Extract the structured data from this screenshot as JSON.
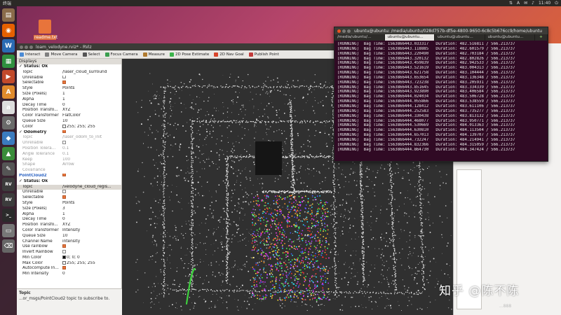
{
  "topbar": {
    "left_label": "终端",
    "time": "11:40",
    "tray": [
      "⇅",
      "A",
      "✉",
      "♪",
      "⏻"
    ]
  },
  "launcher": {
    "items": [
      {
        "name": "files",
        "glyph": "▤",
        "color": "#8a6b4a"
      },
      {
        "name": "firefox",
        "glyph": "◉",
        "color": "#e66000"
      },
      {
        "name": "writer",
        "glyph": "W",
        "color": "#2a6bb3"
      },
      {
        "name": "calc",
        "glyph": "▦",
        "color": "#2f8f3f"
      },
      {
        "name": "impress",
        "glyph": "▶",
        "color": "#c2492b"
      },
      {
        "name": "software",
        "glyph": "A",
        "color": "#e08a2c"
      },
      {
        "name": "amazon",
        "glyph": "a",
        "color": "#dddddd"
      },
      {
        "name": "settings",
        "glyph": "⚙",
        "color": "#6a6a6a"
      },
      {
        "name": "app-blue",
        "glyph": "◆",
        "color": "#3b7bbf"
      },
      {
        "name": "app-green",
        "glyph": "▲",
        "color": "#3a8c3a"
      },
      {
        "name": "editor",
        "glyph": "✎",
        "color": "#555555"
      },
      {
        "name": "rviz-1",
        "glyph": "RV",
        "color": "#3c3c3c"
      },
      {
        "name": "rviz-2",
        "glyph": "RV",
        "color": "#3c3c3c"
      },
      {
        "name": "terminal",
        "glyph": ">_",
        "color": "#2b2b2b"
      },
      {
        "name": "drive",
        "glyph": "▭",
        "color": "#777777"
      },
      {
        "name": "trash",
        "glyph": "⌫",
        "color": "#666666"
      }
    ]
  },
  "desktop": {
    "file_label": "readme.txt"
  },
  "rviz": {
    "title": "loam_velodyne.rviz* - RViz",
    "toolbar": [
      "Interact",
      "Move Camera",
      "Select",
      "Focus Camera",
      "Measure",
      "2D Pose Estimate",
      "2D Nav Goal",
      "Publish Point"
    ],
    "tool_colors": [
      "#4b8bd6",
      "#7f7f7f",
      "#555555",
      "#3a9e4e",
      "#b07a2f",
      "#3cb44b",
      "#d9452b",
      "#c23b3b"
    ],
    "panel_title": "Displays",
    "properties": [
      {
        "k": "✓ Status: Ok",
        "v": "",
        "type": "head"
      },
      {
        "k": "Topic",
        "v": "/laser_cloud_surround"
      },
      {
        "k": "Unreliable",
        "v": "",
        "cb": "off"
      },
      {
        "k": "Selectable",
        "v": "",
        "cb": "on"
      },
      {
        "k": "Style",
        "v": "Points"
      },
      {
        "k": "Size (Pixels)",
        "v": "1"
      },
      {
        "k": "Alpha",
        "v": "1"
      },
      {
        "k": "Decay Time",
        "v": "0"
      },
      {
        "k": "Position Transfo...",
        "v": "XYZ"
      },
      {
        "k": "Color Transformer",
        "v": "FlatColor"
      },
      {
        "k": "Queue Size",
        "v": "10"
      },
      {
        "k": "Color",
        "v": "255; 255; 255",
        "swatch": "#ffffff"
      },
      {
        "k": "✓ Odometry",
        "v": "",
        "type": "head",
        "cb": "on"
      },
      {
        "k": "Topic",
        "v": "/laser_odom_to_init",
        "type": "gray"
      },
      {
        "k": "Unreliable",
        "v": "",
        "type": "gray",
        "cb": "off"
      },
      {
        "k": "Position Tolera...",
        "v": "0.1",
        "type": "gray"
      },
      {
        "k": "Angle Tolerance",
        "v": "0.1",
        "type": "gray"
      },
      {
        "k": "Keep",
        "v": "100",
        "type": "gray"
      },
      {
        "k": "Shape",
        "v": "Arrow",
        "type": "gray"
      },
      {
        "k": "Covariance",
        "v": "",
        "type": "gray"
      },
      {
        "k": "PointCloud2",
        "v": "",
        "type": "blue",
        "cb": "on"
      },
      {
        "k": "✓ Status: Ok",
        "v": "",
        "type": "head"
      },
      {
        "k": "Topic",
        "v": "/velodyne_cloud_regis...",
        "type": "sel"
      },
      {
        "k": "Unreliable",
        "v": "",
        "cb": "off"
      },
      {
        "k": "Selectable",
        "v": "",
        "cb": "on"
      },
      {
        "k": "Style",
        "v": "Points"
      },
      {
        "k": "Size (Pixels)",
        "v": "3"
      },
      {
        "k": "Alpha",
        "v": "1"
      },
      {
        "k": "Decay Time",
        "v": "0"
      },
      {
        "k": "Position Transfo...",
        "v": "XYZ"
      },
      {
        "k": "Color Transformer",
        "v": "Intensity"
      },
      {
        "k": "Queue Size",
        "v": "10"
      },
      {
        "k": "Channel Name",
        "v": "intensity"
      },
      {
        "k": "Use rainbow",
        "v": "",
        "cb": "on"
      },
      {
        "k": "Invert Rainbow",
        "v": "",
        "cb": "off"
      },
      {
        "k": "Min Color",
        "v": "0; 0; 0",
        "swatch": "#000000"
      },
      {
        "k": "Max Color",
        "v": "255; 255; 255",
        "swatch": "#ffffff"
      },
      {
        "k": "Autocompute In...",
        "v": "",
        "cb": "on"
      },
      {
        "k": "Min Intensity",
        "v": "0"
      }
    ],
    "help_title": "Topic",
    "help_text": "...or_msgs/PointCloud2 topic to subscribe to."
  },
  "terminal": {
    "title": "ubuntu@ubuntu: /media/ubuntu/028d757b-df5e-4800-9650-6c8c5b676cc9/home/ubuntu",
    "tabs": [
      "/media/ubuntu/...",
      "ubuntu@ubuntu...",
      "ubuntu@ubuntu...",
      "ubuntu@ubuntu...",
      "+"
    ],
    "lines": [
      "[RUNNING]  Bag Time: 1563866443.033317   Duration: 482.516811 / 566.213737",
      "[RUNNING]  Bag Time: 1563866443.118885   Duration: 482.601579 / 566.213737",
      "[RUNNING]  Bag Time: 1563866443.220490   Duration: 482.703184 / 566.213737",
      "[RUNNING]  Bag Time: 1563866443.320132   Duration: 482.802826 / 566.213737",
      "[RUNNING]  Bag Time: 1563866443.459839   Duration: 482.942533 / 566.213737",
      "[RUNNING]  Bag Time: 1563866443.521619   Duration: 483.004313 / 566.213737",
      "[RUNNING]  Bag Time: 1563866443.621758   Duration: 483.104444 / 566.213737",
      "[RUNNING]  Bag Time: 1563866443.653654   Duration: 483.136348 / 566.213737",
      "[RUNNING]  Bag Time: 1563866443.723238   Duration: 483.205931 / 566.213737",
      "[RUNNING]  Bag Time: 1563866443.851645   Duration: 483.334339 / 566.213737",
      "[RUNNING]  Bag Time: 1563866443.923890   Duration: 483.406584 / 566.213737",
      "[RUNNING]  Bag Time: 1563866444.024034   Duration: 483.506728 / 566.213737",
      "[RUNNING]  Bag Time: 1563866444.055866   Duration: 483.538559 / 566.213737",
      "[RUNNING]  Bag Time: 1563866444.128412   Duration: 483.611106 / 566.213737",
      "[RUNNING]  Bag Time: 1563866444.252583   Duration: 483.735277 / 566.213737",
      "[RUNNING]  Bag Time: 1563866444.330438   Duration: 483.813132 / 566.213737",
      "[RUNNING]  Bag Time: 1563866444.468077   Duration: 483.950771 / 566.213737",
      "[RUNNING]  Bag Time: 1563866444.530669   Duration: 484.013363 / 566.213737",
      "[RUNNING]  Bag Time: 1563866444.630810   Duration: 484.113504 / 566.213737",
      "[RUNNING]  Bag Time: 1563866444.657013   Duration: 484.139707 / 566.213737",
      "[RUNNING]  Bag Time: 1563866444.732247   Duration: 484.214941 / 566.213737",
      "[RUNNING]  Bag Time: 1563866444.832366   Duration: 484.315059 / 566.213737",
      "[RUNNING]  Bag Time: 1563866444.864730   Duration: 484.347424 / 566.213737"
    ]
  },
  "watermark": {
    "text": "知乎 @陈不陈",
    "sub": "...888"
  }
}
